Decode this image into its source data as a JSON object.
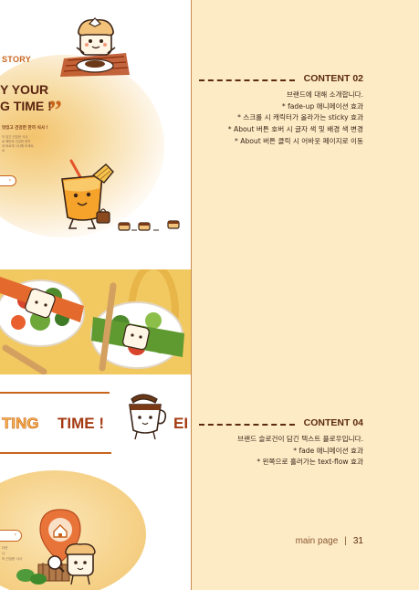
{
  "preview": {
    "story_label": "STORY",
    "hero_line1": "Y YOUR",
    "hero_line2": "G TIME !",
    "quote_mark": "”",
    "hero_sub": "맛있고 건강한 한끼 식사 !",
    "hero_desc": [
      "이 담긴 건강한 식사,",
      "로 패턴과 건강한 한끼",
      "과 바르게 식사해 보세요.",
      "요"
    ],
    "pill_arrow": "›",
    "slogan_a": "TING",
    "slogan_b": "TIME !",
    "slogan_c": "EI",
    "bottom_arrow": "›",
    "bottom_text": [
      "다운",
      "나",
      "의 건강한 식사"
    ]
  },
  "panel": {
    "content02": {
      "title": "CONTENT 02",
      "lines": [
        "브랜드에 대해 소개합니다.",
        "* fade-up 애니메이션 효과",
        "* 스크롤 시 캐릭터가 올라가는 sticky 효과",
        "* About 버튼 호버 시 글자 색 및 배경 색 변경",
        "* About 버튼 클릭 시 어바웃 페이지로 이동"
      ]
    },
    "content04": {
      "title": "CONTENT 04",
      "lines": [
        "브랜드 슬로건이 담긴 텍스트 플로우입니다.",
        "* fade 애니메이션 효과",
        "* 왼쪽으로 흘러가는 text-flow 효과"
      ]
    },
    "footer": {
      "label": "main page",
      "separator": "|",
      "page_number": "31"
    }
  },
  "colors": {
    "panel_bg": "#fdebc6",
    "accent_brown": "#5c2a10",
    "accent_orange": "#c8641c",
    "band_yellow": "#f1c960"
  }
}
